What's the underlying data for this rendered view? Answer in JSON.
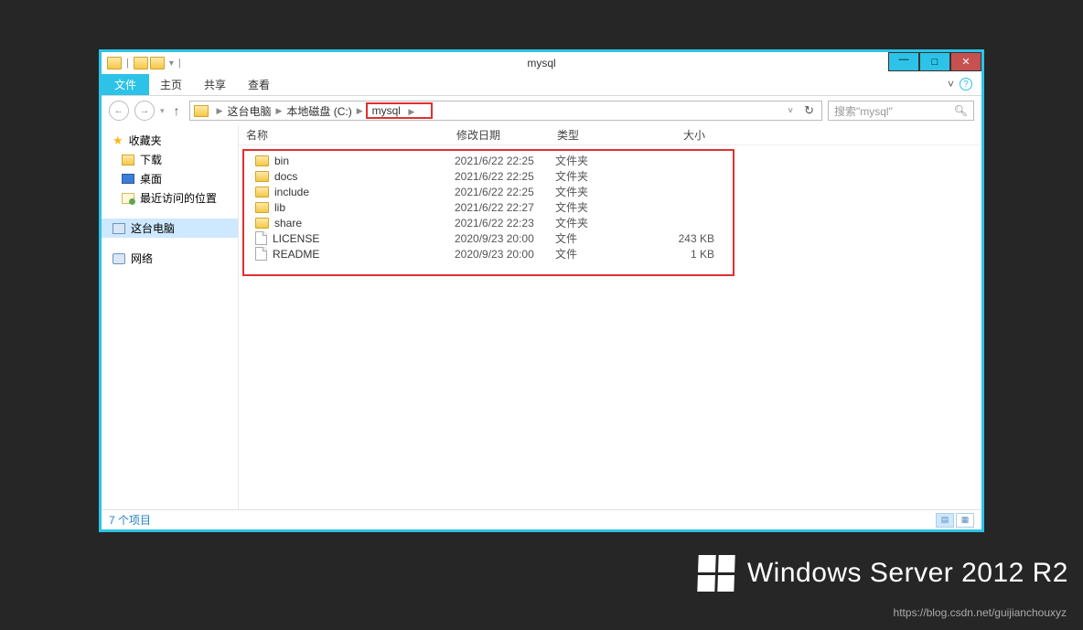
{
  "window": {
    "title": "mysql"
  },
  "ribbon": {
    "file": "文件",
    "tabs": [
      "主页",
      "共享",
      "查看"
    ]
  },
  "breadcrumb": {
    "items": [
      "这台电脑",
      "本地磁盘 (C:)",
      "mysql"
    ]
  },
  "search": {
    "placeholder": "搜索\"mysql\""
  },
  "nav_pane": {
    "favorites_label": "收藏夹",
    "downloads": "下载",
    "desktop": "桌面",
    "recent": "最近访问的位置",
    "this_pc": "这台电脑",
    "network": "网络"
  },
  "columns": {
    "name": "名称",
    "date": "修改日期",
    "type": "类型",
    "size": "大小"
  },
  "files": [
    {
      "icon": "folder",
      "name": "bin",
      "date": "2021/6/22 22:25",
      "type": "文件夹",
      "size": ""
    },
    {
      "icon": "folder",
      "name": "docs",
      "date": "2021/6/22 22:25",
      "type": "文件夹",
      "size": ""
    },
    {
      "icon": "folder",
      "name": "include",
      "date": "2021/6/22 22:25",
      "type": "文件夹",
      "size": ""
    },
    {
      "icon": "folder",
      "name": "lib",
      "date": "2021/6/22 22:27",
      "type": "文件夹",
      "size": ""
    },
    {
      "icon": "folder",
      "name": "share",
      "date": "2021/6/22 22:23",
      "type": "文件夹",
      "size": ""
    },
    {
      "icon": "file",
      "name": "LICENSE",
      "date": "2020/9/23 20:00",
      "type": "文件",
      "size": "243 KB"
    },
    {
      "icon": "file",
      "name": "README",
      "date": "2020/9/23 20:00",
      "type": "文件",
      "size": "1 KB"
    }
  ],
  "status": {
    "count_label": "7 个项目"
  },
  "branding": {
    "text": "Windows Server 2012 R2"
  },
  "watermark": "https://blog.csdn.net/guijianchouxyz"
}
